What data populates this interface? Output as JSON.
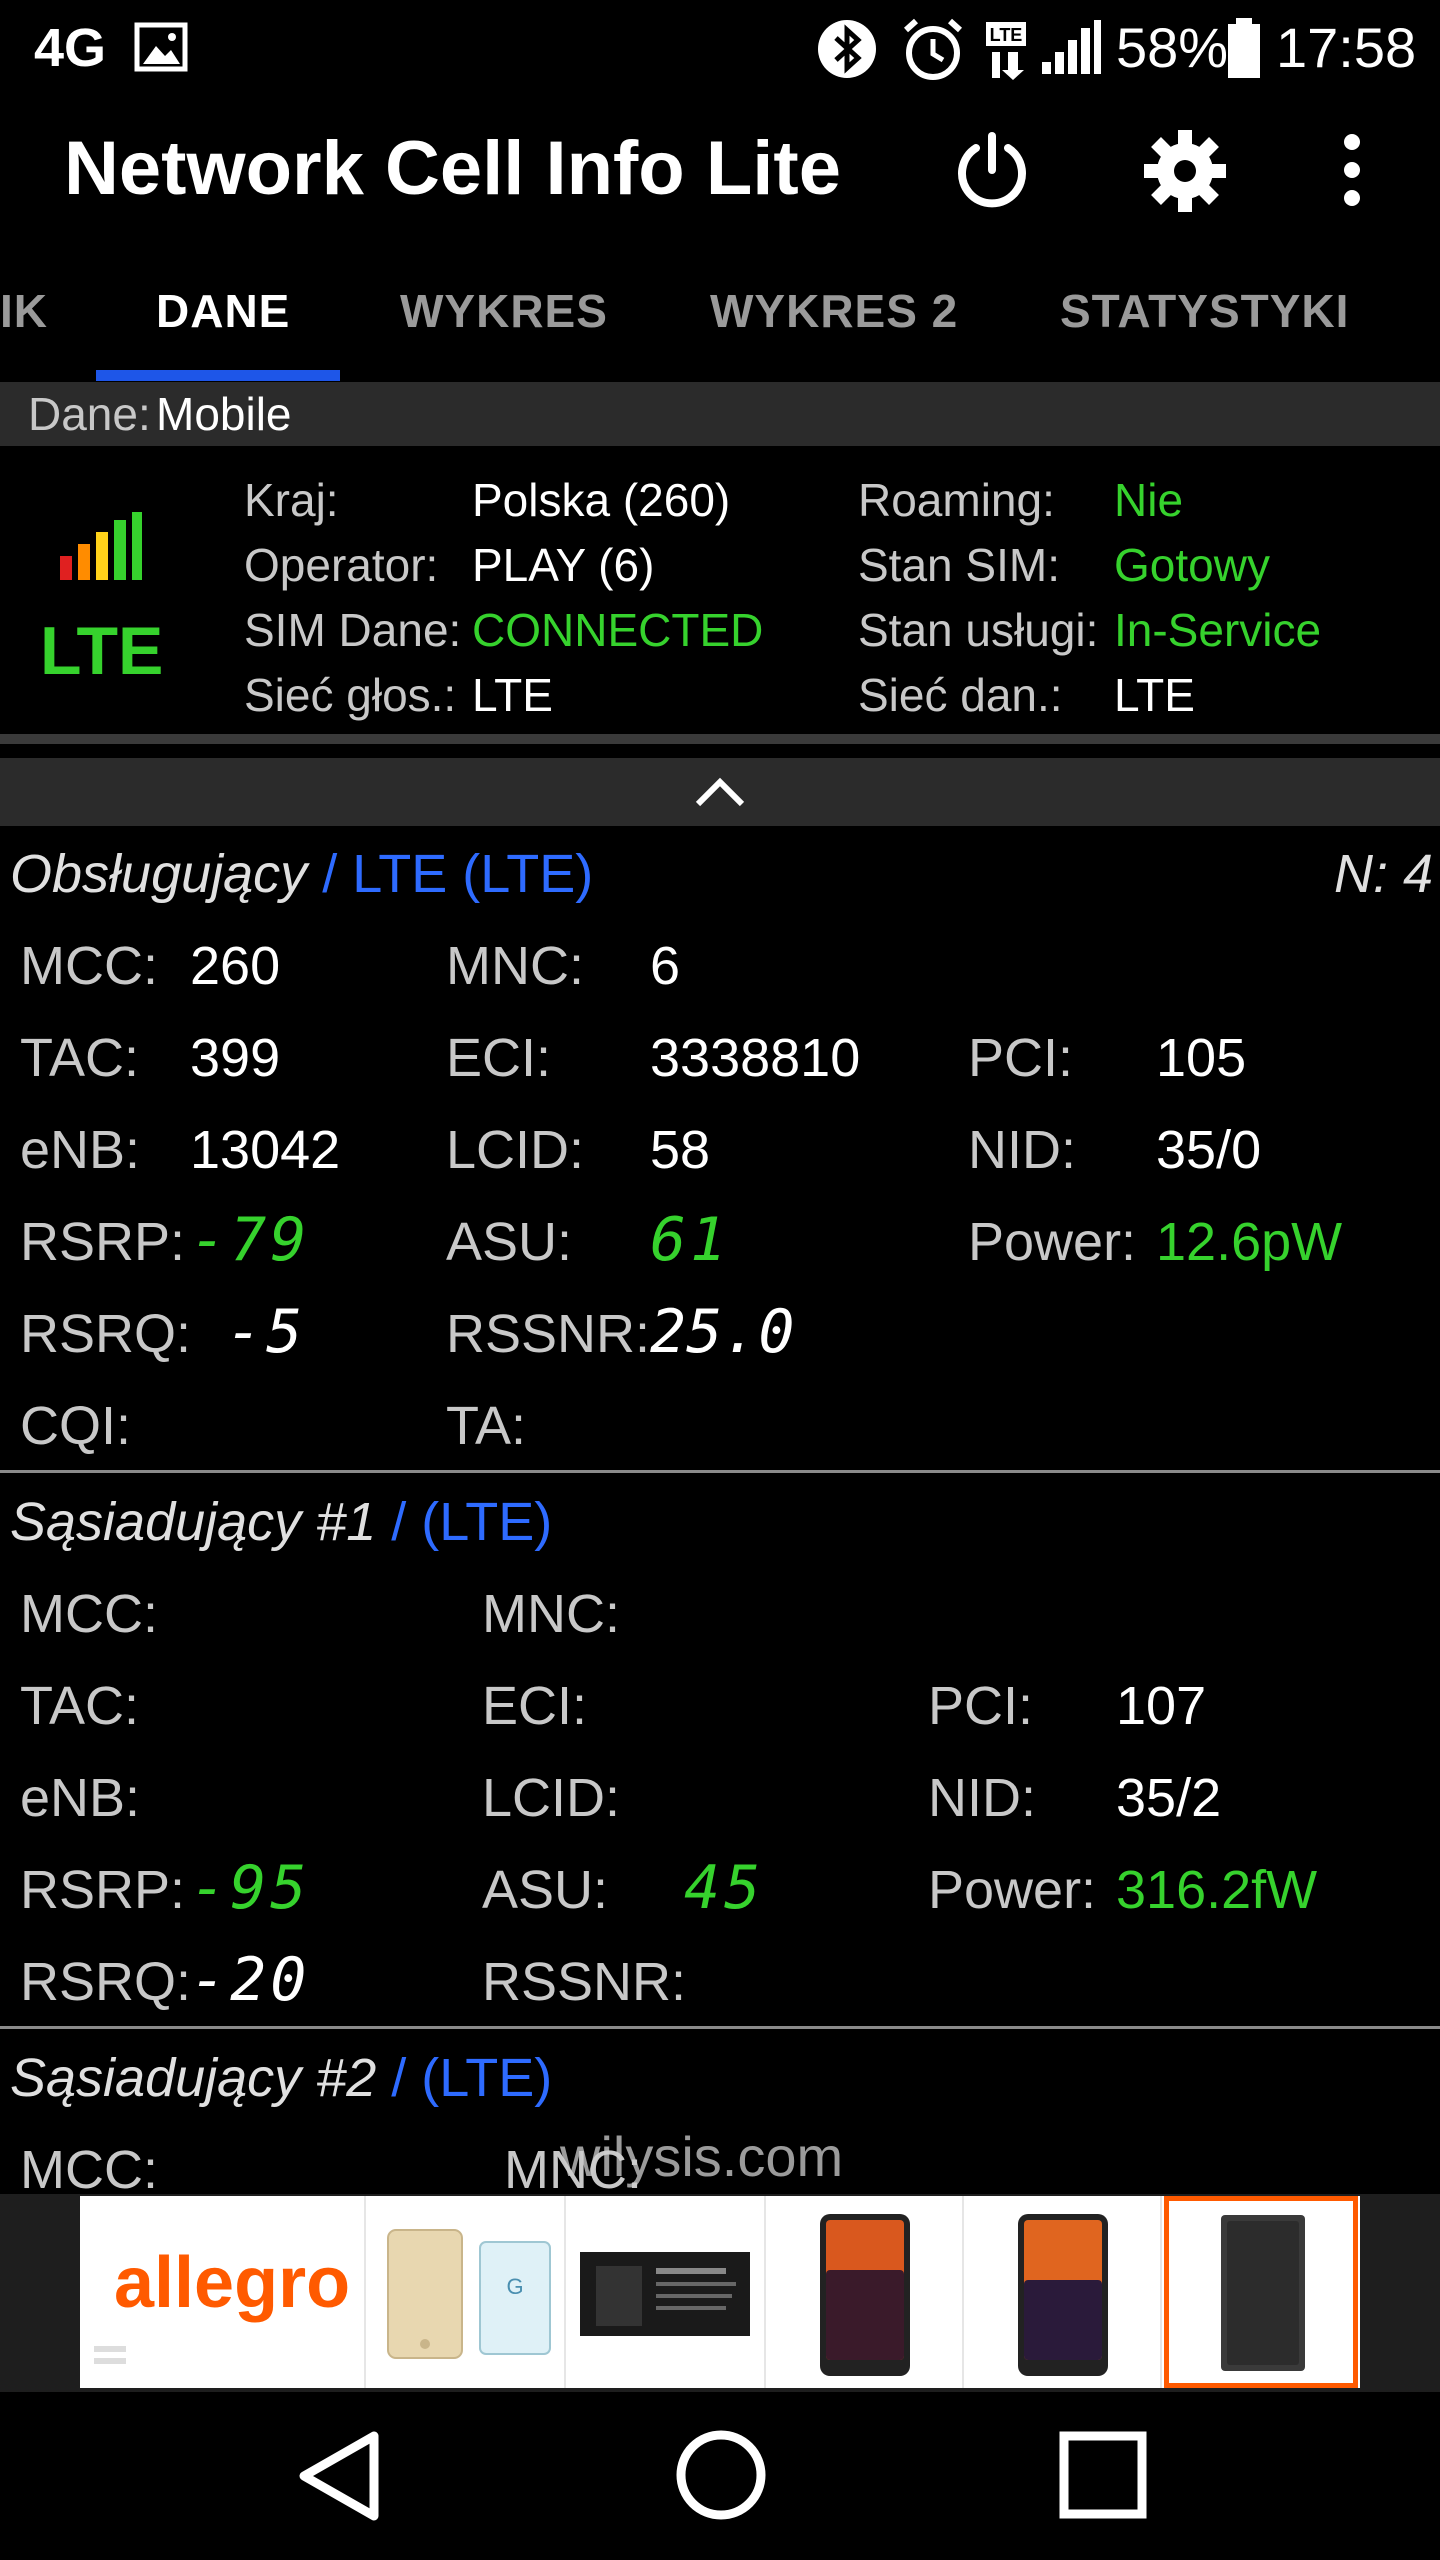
{
  "status_bar": {
    "network": "4G",
    "battery": "58%",
    "time": "17:58"
  },
  "app": {
    "title": "Network Cell Info Lite"
  },
  "tabs": [
    {
      "label": "IK"
    },
    {
      "label": "DANE",
      "active": true
    },
    {
      "label": "WYKRES"
    },
    {
      "label": "WYKRES 2"
    },
    {
      "label": "STATYSTYKI"
    }
  ],
  "data_band": {
    "label": "Dane:",
    "value": "Mobile"
  },
  "summary": {
    "tech": "LTE",
    "rows": [
      {
        "label": "Kraj:",
        "value": "Polska (260)",
        "label2": "Roaming:",
        "value2": "Nie"
      },
      {
        "label": "Operator:",
        "value": "PLAY (6)",
        "label2": "Stan SIM:",
        "value2": "Gotowy"
      },
      {
        "label": "SIM Dane:",
        "value": "CONNECTED",
        "label2": "Stan usługi:",
        "value2": "In-Service"
      },
      {
        "label": "Sieć głos.:",
        "value": "LTE",
        "label2": "Sieć dan.:",
        "value2": "LTE"
      }
    ]
  },
  "serving": {
    "title": "Obsługujący",
    "slash": "/",
    "tech": "LTE (LTE)",
    "n": "N: 4",
    "mcc_l": "MCC:",
    "mcc": "260",
    "mnc_l": "MNC:",
    "mnc": "6",
    "tac_l": "TAC:",
    "tac": "399",
    "eci_l": "ECI:",
    "eci": "3338810",
    "pci_l": "PCI:",
    "pci": "105",
    "enb_l": "eNB:",
    "enb": "13042",
    "lcid_l": "LCID:",
    "lcid": "58",
    "nid_l": "NID:",
    "nid": "35/0",
    "rsrp_l": "RSRP:",
    "rsrp": "-79",
    "asu_l": "ASU:",
    "asu": "61",
    "power_l": "Power:",
    "power": "12.6pW",
    "rsrq_l": "RSRQ:",
    "rsrq": "-5",
    "rssnr_l": "RSSNR:",
    "rssnr": "25.0",
    "cqi_l": "CQI:",
    "ta_l": "TA:"
  },
  "neighbor1": {
    "title": "Sąsiadujący #1",
    "slash": "/",
    "tech": "(LTE)",
    "mcc_l": "MCC:",
    "mnc_l": "MNC:",
    "tac_l": "TAC:",
    "eci_l": "ECI:",
    "pci_l": "PCI:",
    "pci": "107",
    "enb_l": "eNB:",
    "lcid_l": "LCID:",
    "nid_l": "NID:",
    "nid": "35/2",
    "rsrp_l": "RSRP:",
    "rsrp": "-95",
    "asu_l": "ASU:",
    "asu": "45",
    "power_l": "Power:",
    "power": "316.2fW",
    "rsrq_l": "RSRQ:",
    "rsrq": "-20",
    "rssnr_l": "RSSNR:"
  },
  "neighbor2": {
    "title": "Sąsiadujący #2",
    "slash": "/",
    "tech": "(LTE)",
    "mcc_l": "MCC:",
    "mnc_l": "MNC:"
  },
  "watermark": "wilysis.com",
  "ad": {
    "brand": "allegro"
  },
  "colors": {
    "accent": "#1e56e8",
    "green": "#36d22d",
    "blue": "#2e6bff",
    "ad_orange": "#ff5a00"
  }
}
